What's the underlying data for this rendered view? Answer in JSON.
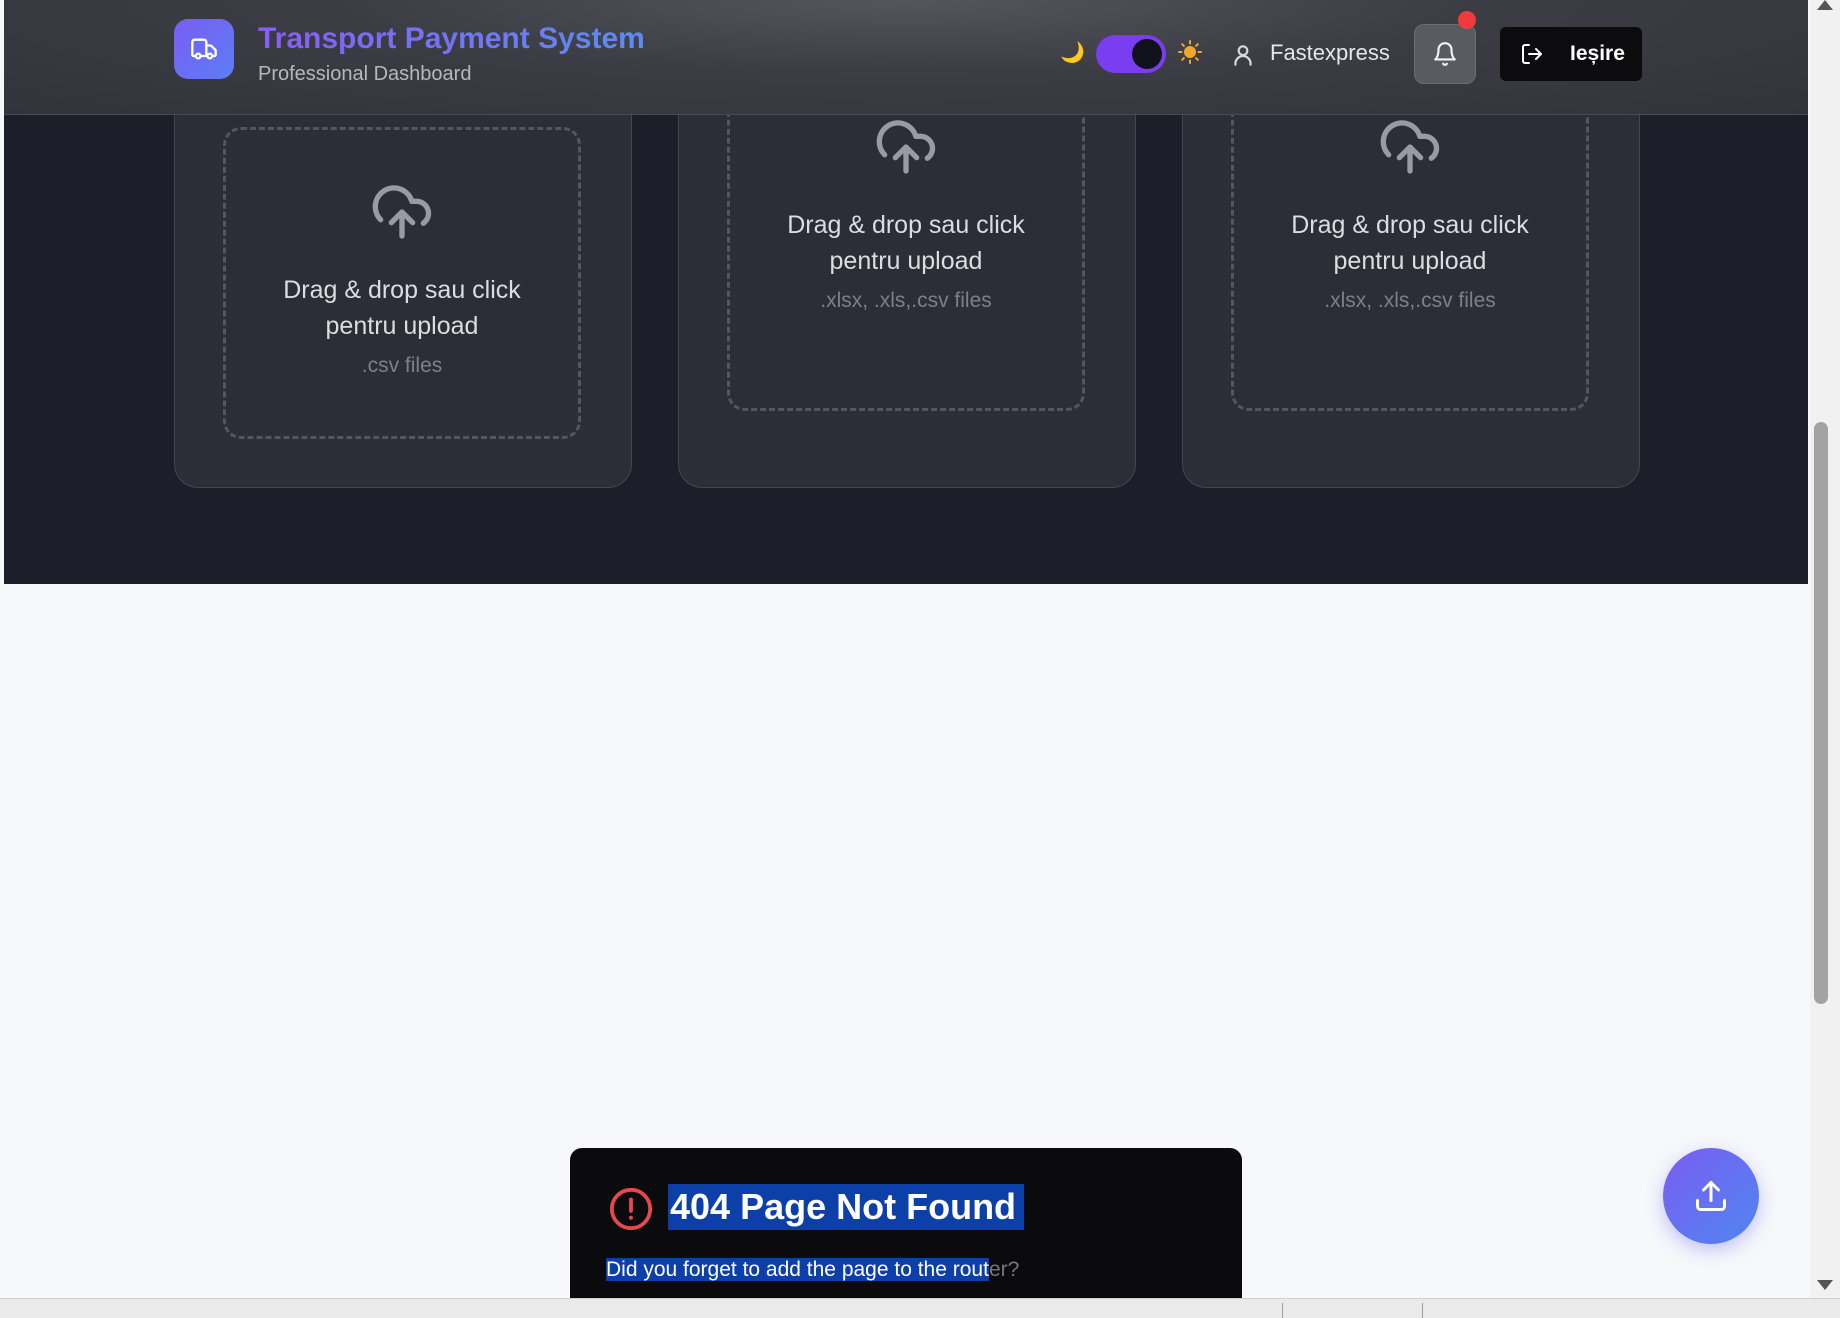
{
  "header": {
    "title": "Transport Payment System",
    "subtitle": "Professional Dashboard",
    "user_name": "Fastexpress",
    "logout_label": "Ieșire",
    "theme_toggle_state": "dark",
    "notification_dot": true
  },
  "upload_cards": [
    {
      "drop_text_1": "Drag & drop sau click",
      "drop_text_2": "pentru upload",
      "formats": ".csv files"
    },
    {
      "drop_text_1": "Drag & drop sau click",
      "drop_text_2": "pentru upload",
      "formats": ".xlsx, .xls,.csv files"
    },
    {
      "drop_text_1": "Drag & drop sau click",
      "drop_text_2": "pentru upload",
      "formats": ".xlsx, .xls,.csv files"
    }
  ],
  "error_toast": {
    "title": "404 Page Not Found",
    "message_selected": "Did you forget to add the page to the rout",
    "message_rest": "er?"
  },
  "colors": {
    "accent": "#7a3df0",
    "error": "#ef3b3b",
    "dark_bg": "#1e1e2b",
    "page_bg": "#f7f8fa",
    "selection": "#0c3fa8"
  },
  "icons": [
    "truck-icon",
    "moon-icon",
    "sun-icon",
    "user-icon",
    "bell-icon",
    "logout-icon",
    "cloud-upload-icon",
    "alert-circle-icon",
    "upload-icon"
  ]
}
